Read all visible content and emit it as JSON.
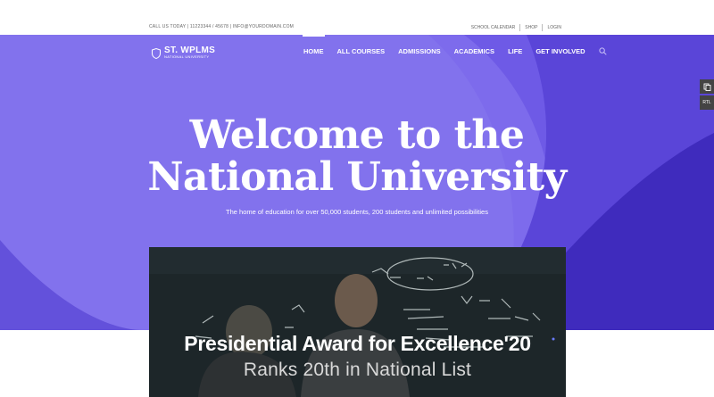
{
  "topbar": {
    "contact": "CALL US TODAY | 11223344 / 45678 | INFO@YOURDOMAIN.COM",
    "links": [
      "SCHOOL CALENDAR",
      "SHOP",
      "LOGIN"
    ]
  },
  "logo": {
    "name": "ST. WPLMS",
    "subtitle": "NATIONAL UNIVERSITY"
  },
  "nav": {
    "items": [
      "HOME",
      "ALL COURSES",
      "ADMISSIONS",
      "ACADEMICS",
      "LIFE",
      "GET INVOLVED"
    ],
    "active": "HOME"
  },
  "hero": {
    "line1": "Welcome to the",
    "line2": "National University",
    "tagline": "The home of education for over 50,000 students, 200 students and unlimited possibilities"
  },
  "card": {
    "award": "Presidential Award for Excellence'20",
    "rank": "Ranks 20th in National List"
  },
  "side_widgets": [
    "copy-icon",
    "RTL"
  ],
  "colors": {
    "hero_light": "#7f6ff0",
    "hero_mid": "#6e5ae6",
    "hero_dark": "#4b36c9",
    "white": "#ffffff"
  }
}
